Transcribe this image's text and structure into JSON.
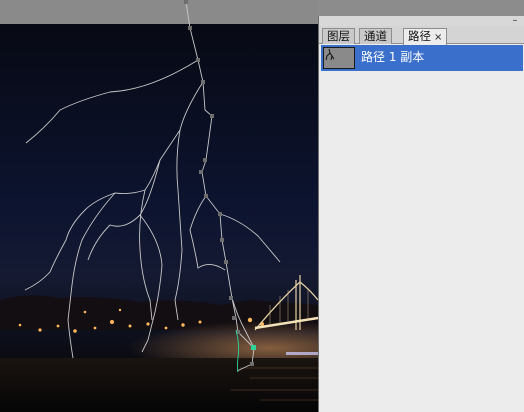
{
  "panel": {
    "tabs": [
      {
        "label": "图层",
        "active": false
      },
      {
        "label": "通道",
        "active": false
      },
      {
        "label": "路径",
        "active": true
      }
    ],
    "close_glyph": "×",
    "paths": [
      {
        "label": "路径 1 副本",
        "selected": true
      }
    ],
    "minimize_glyph": "–",
    "menu_glyph": "▾"
  },
  "colors": {
    "selection": "#3a6fcb",
    "panel_bg": "#ececec",
    "path_stroke": "#c8c8c8",
    "anchor": "#6e6e6e",
    "active_anchor": "#2fd39a"
  }
}
